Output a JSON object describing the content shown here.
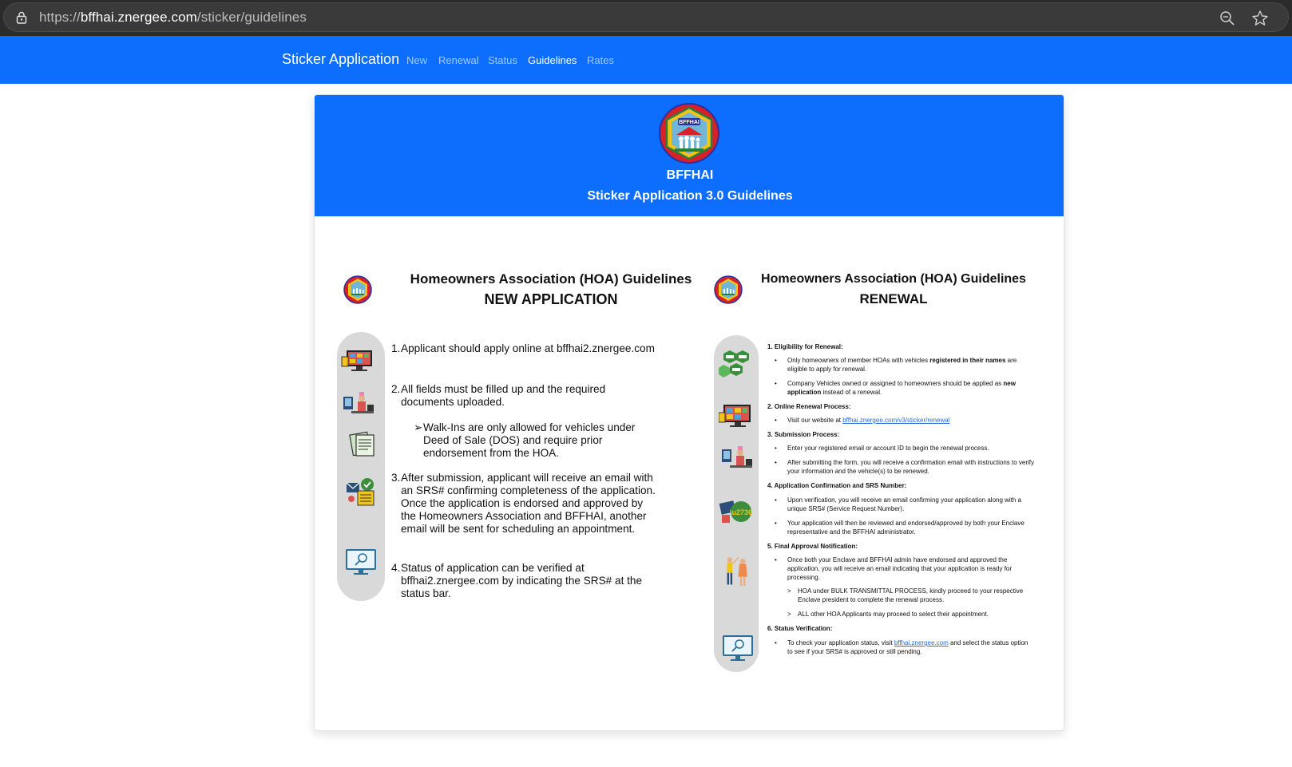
{
  "browser": {
    "url_prefix": "https://",
    "url_host": "bffhai.znergee.com",
    "url_path": "/sticker/guidelines"
  },
  "navbar": {
    "brand": "Sticker Application",
    "links": [
      {
        "label": "New",
        "active": false
      },
      {
        "label": "Renewal",
        "active": false
      },
      {
        "label": "Status",
        "active": false
      },
      {
        "label": "Guidelines",
        "active": true
      },
      {
        "label": "Rates",
        "active": false
      }
    ],
    "color": "#0d6efd"
  },
  "card": {
    "seal_text": "BFFHAI",
    "org": "BFFHAI",
    "title": "Sticker Application 3.0 Guidelines"
  },
  "new_application": {
    "heading": "Homeowners Association (HOA) Guidelines",
    "subheading": "NEW APPLICATION",
    "steps": [
      {
        "num": "1.",
        "text": "Applicant should apply online at bffhai2.znergee.com"
      },
      {
        "num": "2.",
        "text": "All fields must be filled up and the required documents uploaded."
      },
      {
        "num": "➢",
        "text": "Walk-Ins are only allowed for vehicles under Deed of Sale (DOS) and require prior endorsement from the HOA."
      },
      {
        "num": "3.",
        "text": "After submission, applicant will receive an email with an SRS# confirming completeness of the application. Once the application is endorsed and approved by the Homeowners Association and BFFHAI, another email will be sent for scheduling an appointment."
      },
      {
        "num": "4.",
        "text": "Status of application can be verified at bffhai2.znergee.com by indicating the SRS# at the status bar."
      }
    ],
    "icons": [
      "monitor-screen-icon",
      "person-at-desk-icon",
      "documents-icon",
      "email-checklist-icon",
      "search-monitor-icon"
    ]
  },
  "renewal": {
    "heading": "Homeowners Association (HOA) Guidelines",
    "subheading": "RENEWAL",
    "sections": [
      {
        "title": "1. Eligibility for Renewal:",
        "items": [
          {
            "pre": "Only homeowners of member HOAs with vehicles ",
            "bold": "registered in their names",
            "post": " are eligible to apply for renewal."
          },
          {
            "pre": "Company Vehicles owned or assigned to homeowners should be applied as ",
            "bold": "new application",
            "post": " instead of a renewal."
          }
        ]
      },
      {
        "title": "2. Online Renewal Process:",
        "items": [
          {
            "pre": "Visit our website at ",
            "link": "bffhai.znergee.com/v3/sticker/renewal",
            "post": ""
          }
        ]
      },
      {
        "title": "3. Submission Process:",
        "items": [
          {
            "pre": "Enter your registered email or account ID to begin the renewal process.",
            "post": ""
          },
          {
            "pre": "After submitting the form, you will receive a confirmation email with instructions to verify your information and the vehicle(s) to be renewed.",
            "post": ""
          }
        ]
      },
      {
        "title": "4. Application Confirmation and SRS Number:",
        "items": [
          {
            "pre": "Upon verification, you will receive an email confirming your application along with a unique SRS# (Service Request Number).",
            "post": ""
          },
          {
            "pre": "Your application will then be reviewed and endorsed/approved by both your Enclave representative and the BFFHAI administrator.",
            "post": ""
          }
        ]
      },
      {
        "title": "5. Final Approval Notification:",
        "items": [
          {
            "pre": "Once both your Enclave and BFFHAI admin have endorsed and approved the application, you will receive an email indicating that your application is ready for processing.",
            "post": ""
          }
        ],
        "subitems": [
          "HOA under BULK TRANSMITTAL PROCESS, kindly proceed to your respective Enclave president to complete the renewal process.",
          "ALL other HOA Applicants may proceed to select their appointment."
        ]
      },
      {
        "title": "6. Status Verification:",
        "items": [
          {
            "pre": "To check your application status, visit ",
            "link": "bffhai.znergee.com",
            "post": " and select the status option to see if your SRS# is approved or still pending."
          }
        ]
      }
    ],
    "icons": [
      "car-hexagons-icon",
      "monitor-screen-icon",
      "person-at-desk-icon",
      "email-badge-icon",
      "two-people-icon",
      "search-monitor-icon"
    ]
  }
}
